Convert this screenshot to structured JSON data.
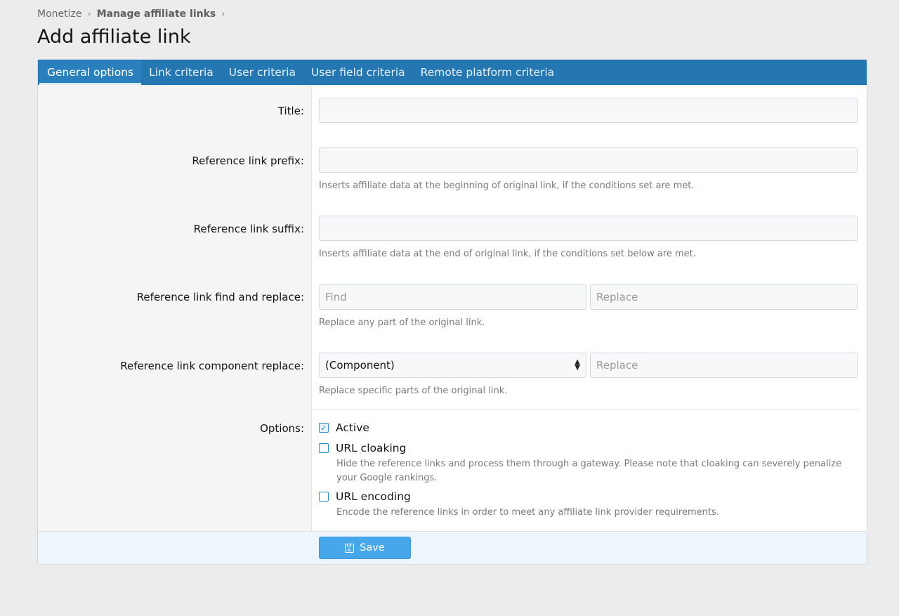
{
  "breadcrumb": {
    "items": [
      "Monetize",
      "Manage affiliate links"
    ],
    "separator": "›"
  },
  "page_title": "Add affiliate link",
  "tabs": [
    {
      "label": "General options",
      "active": true
    },
    {
      "label": "Link criteria",
      "active": false
    },
    {
      "label": "User criteria",
      "active": false
    },
    {
      "label": "User field criteria",
      "active": false
    },
    {
      "label": "Remote platform criteria",
      "active": false
    }
  ],
  "form": {
    "title": {
      "label": "Title:",
      "value": ""
    },
    "prefix": {
      "label": "Reference link prefix:",
      "value": "",
      "hint": "Inserts affiliate data at the beginning of original link, if the conditions set are met."
    },
    "suffix": {
      "label": "Reference link suffix:",
      "value": "",
      "hint": "Inserts affiliate data at the end of original link, if the conditions set below are met."
    },
    "find_replace": {
      "label": "Reference link find and replace:",
      "find_placeholder": "Find",
      "replace_placeholder": "Replace",
      "hint": "Replace any part of the original link."
    },
    "component_replace": {
      "label": "Reference link component replace:",
      "selected": "(Component)",
      "replace_placeholder": "Replace",
      "hint": "Replace specific parts of the original link."
    },
    "options": {
      "label": "Options:",
      "active": {
        "label": "Active",
        "checked": true
      },
      "cloaking": {
        "label": "URL cloaking",
        "checked": false,
        "hint": "Hide the reference links and process them through a gateway. Please note that cloaking can severely penalize your Google rankings."
      },
      "encoding": {
        "label": "URL encoding",
        "checked": false,
        "hint": "Encode the reference links in order to meet any affiliate link provider requirements."
      }
    }
  },
  "footer": {
    "save_label": "Save",
    "save_icon": "save-icon"
  },
  "colors": {
    "tab_bar": "#2577b1",
    "save_button": "#47a7eb",
    "checkbox": "#2b8ad0"
  }
}
